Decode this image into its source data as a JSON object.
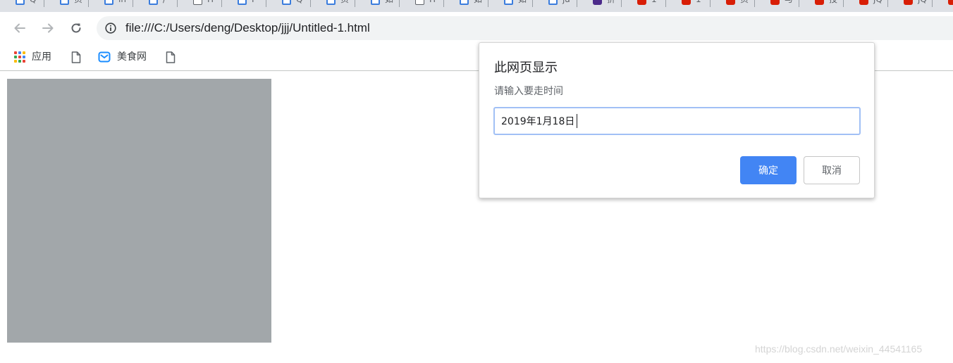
{
  "browser": {
    "address_url": "file:///C:/Users/deng/Desktop/jjj/Untitled-1.html"
  },
  "tabs": [
    {
      "favicon": "baidu-icon",
      "title": "Q"
    },
    {
      "favicon": "baidu-icon",
      "title": "页"
    },
    {
      "favicon": "baidu-icon",
      "title": "in"
    },
    {
      "favicon": "baidu-icon",
      "title": "/"
    },
    {
      "favicon": "document-icon",
      "title": "H"
    },
    {
      "favicon": "baidu-icon",
      "title": "I"
    },
    {
      "favicon": "baidu-icon",
      "title": "Q"
    },
    {
      "favicon": "baidu-icon",
      "title": "页"
    },
    {
      "favicon": "baidu-icon",
      "title": "如"
    },
    {
      "favicon": "document-icon",
      "title": "H"
    },
    {
      "favicon": "baidu-icon",
      "title": "如"
    },
    {
      "favicon": "baidu-icon",
      "title": "如"
    },
    {
      "favicon": "baidu-icon",
      "title": "ja"
    },
    {
      "favicon": "site-purple-icon",
      "title": "折"
    },
    {
      "favicon": "csdn-icon",
      "title": "1"
    },
    {
      "favicon": "csdn-icon",
      "title": "1"
    },
    {
      "favicon": "csdn-icon",
      "title": "页"
    },
    {
      "favicon": "csdn-icon",
      "title": "与"
    },
    {
      "favicon": "csdn-icon",
      "title": "技"
    },
    {
      "favicon": "csdn-icon",
      "title": "jQ"
    },
    {
      "favicon": "csdn-icon",
      "title": "jQ"
    },
    {
      "favicon": "csdn-icon",
      "title": ""
    }
  ],
  "bookmarks": {
    "apps_label": "应用",
    "items": [
      {
        "icon": "document-icon",
        "label": ""
      },
      {
        "icon": "mail-icon",
        "label": "美食网"
      },
      {
        "icon": "document-icon",
        "label": ""
      }
    ]
  },
  "dialog": {
    "title": "此网页显示",
    "message": "请输入要走时间",
    "input_value": "2019年1月18日",
    "ok_label": "确定",
    "cancel_label": "取消"
  },
  "watermark": "https://blog.csdn.net/weixin_44541165",
  "colors": {
    "accent": "#4285f4",
    "box_grey": "#a2a7aa",
    "tabstrip": "#dee1e6",
    "omnibox": "#f1f3f4",
    "csdn_red": "#d81e06"
  }
}
